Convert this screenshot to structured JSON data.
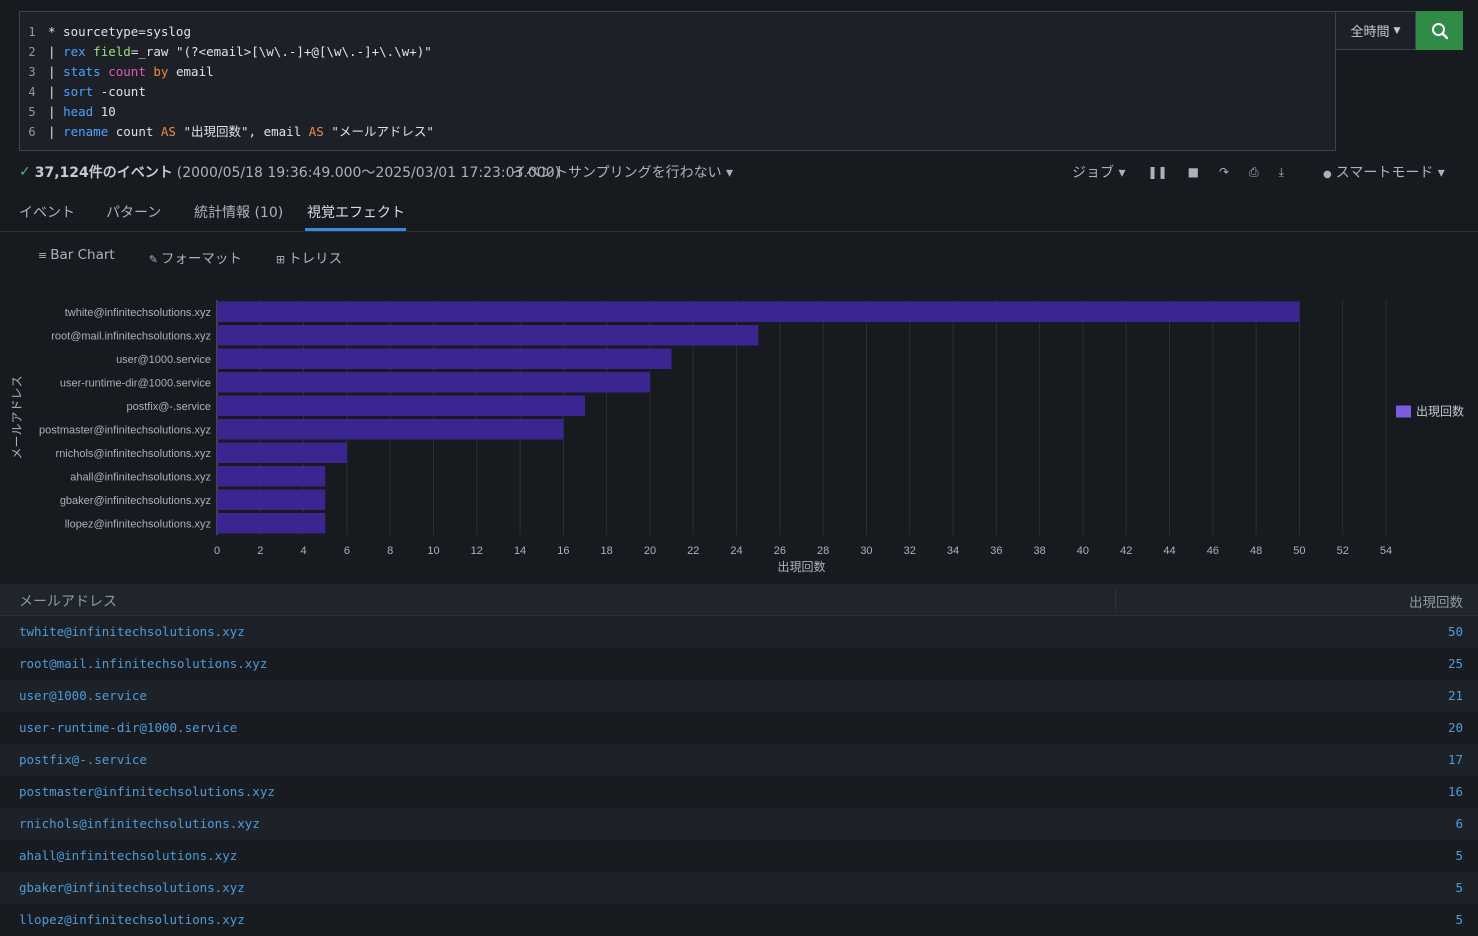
{
  "search": {
    "line_numbers": [
      "1",
      "2",
      "3",
      "4",
      "5",
      "6"
    ],
    "time_picker_label": "全時間",
    "query_lines": [
      [
        {
          "t": "* sourcetype=syslog",
          "c": ""
        }
      ],
      [
        {
          "t": "| ",
          "c": ""
        },
        {
          "t": "rex",
          "c": "kw-blue"
        },
        {
          "t": " ",
          "c": ""
        },
        {
          "t": "field",
          "c": "kw-green"
        },
        {
          "t": "=_raw \"(?<email>[\\w\\.-]+@[\\w\\.-]+\\.\\w+)\"",
          "c": ""
        }
      ],
      [
        {
          "t": "| ",
          "c": ""
        },
        {
          "t": "stats",
          "c": "kw-blue"
        },
        {
          "t": " ",
          "c": ""
        },
        {
          "t": "count",
          "c": "kw-pink"
        },
        {
          "t": " ",
          "c": ""
        },
        {
          "t": "by",
          "c": "kw-orange"
        },
        {
          "t": " email",
          "c": ""
        }
      ],
      [
        {
          "t": "| ",
          "c": ""
        },
        {
          "t": "sort",
          "c": "kw-blue"
        },
        {
          "t": " -count",
          "c": ""
        }
      ],
      [
        {
          "t": "| ",
          "c": ""
        },
        {
          "t": "head",
          "c": "kw-blue"
        },
        {
          "t": " 10",
          "c": ""
        }
      ],
      [
        {
          "t": "| ",
          "c": ""
        },
        {
          "t": "rename",
          "c": "kw-blue"
        },
        {
          "t": " count ",
          "c": ""
        },
        {
          "t": "AS",
          "c": "kw-orange"
        },
        {
          "t": " \"出現回数\", email ",
          "c": ""
        },
        {
          "t": "AS",
          "c": "kw-orange"
        },
        {
          "t": " \"メールアドレス\"",
          "c": ""
        }
      ]
    ]
  },
  "status": {
    "check": "✓",
    "event_count": "37,124件のイベント",
    "time_range": "(2000/05/18 19:36:49.000〜2025/03/01 17:23:03.000)",
    "sampling": "イベントサンプリングを行わない ▾",
    "job": "ジョブ ▾",
    "smart_mode": "スマートモード ▾"
  },
  "tabs": [
    "イベント",
    "パターン",
    "統計情報 (10)",
    "視覚エフェクト"
  ],
  "viz_toolbar": {
    "bar_chart": "Bar Chart",
    "format": "フォーマット",
    "trellis": "トレリス"
  },
  "chart_data": {
    "type": "bar",
    "orientation": "horizontal",
    "categories": [
      "twhite@infinitechsolutions.xyz",
      "root@mail.infinitechsolutions.xyz",
      "user@1000.service",
      "user-runtime-dir@1000.service",
      "postfix@-.service",
      "postmaster@infinitechsolutions.xyz",
      "rnichols@infinitechsolutions.xyz",
      "ahall@infinitechsolutions.xyz",
      "gbaker@infinitechsolutions.xyz",
      "llopez@infinitechsolutions.xyz"
    ],
    "series": [
      {
        "name": "出現回数",
        "values": [
          50,
          25,
          21,
          20,
          17,
          16,
          6,
          5,
          5,
          5
        ],
        "color": "#3b2590"
      }
    ],
    "xlabel": "出現回数",
    "ylabel": "メールアドレス",
    "xlim": [
      0,
      54
    ],
    "xticks": [
      0,
      2,
      4,
      6,
      8,
      10,
      12,
      14,
      16,
      18,
      20,
      22,
      24,
      26,
      28,
      30,
      32,
      34,
      36,
      38,
      40,
      42,
      44,
      46,
      48,
      50,
      52,
      54
    ],
    "grid": true,
    "legend": "right",
    "legend_color": "#7d5ce0"
  },
  "table": {
    "headers": [
      "メールアドレス",
      "出現回数"
    ],
    "rows": [
      [
        "twhite@infinitechsolutions.xyz",
        "50"
      ],
      [
        "root@mail.infinitechsolutions.xyz",
        "25"
      ],
      [
        "user@1000.service",
        "21"
      ],
      [
        "user-runtime-dir@1000.service",
        "20"
      ],
      [
        "postfix@-.service",
        "17"
      ],
      [
        "postmaster@infinitechsolutions.xyz",
        "16"
      ],
      [
        "rnichols@infinitechsolutions.xyz",
        "6"
      ],
      [
        "ahall@infinitechsolutions.xyz",
        "5"
      ],
      [
        "gbaker@infinitechsolutions.xyz",
        "5"
      ],
      [
        "llopez@infinitechsolutions.xyz",
        "5"
      ]
    ]
  }
}
